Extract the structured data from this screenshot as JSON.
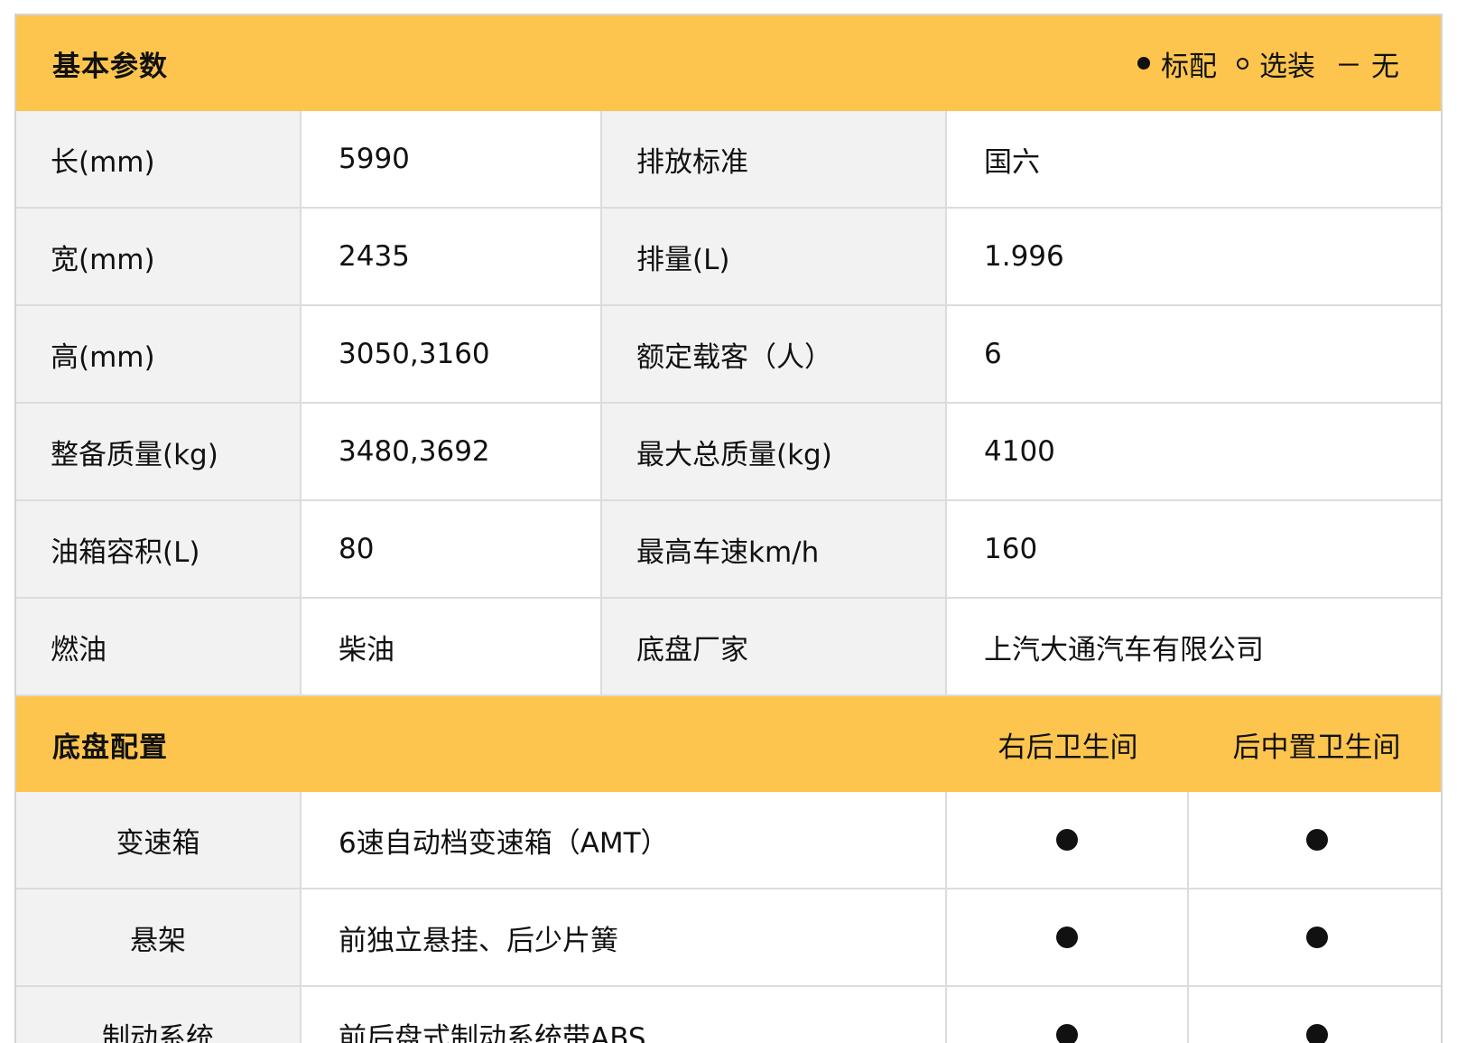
{
  "basic": {
    "title": "基本参数",
    "legend": {
      "standard_label": "标配",
      "optional_label": "选装",
      "none_symbol": "－",
      "none_label": "无"
    },
    "rows": [
      {
        "label1": "长(mm)",
        "value1": "5990",
        "label2": "排放标准",
        "value2": "国六"
      },
      {
        "label1": "宽(mm)",
        "value1": "2435",
        "label2": "排量(L)",
        "value2": "1.996"
      },
      {
        "label1": "高(mm)",
        "value1": "3050,3160",
        "label2": "额定载客（人）",
        "value2": "6"
      },
      {
        "label1": "整备质量(kg)",
        "value1": "3480,3692",
        "label2": "最大总质量(kg)",
        "value2": "4100"
      },
      {
        "label1": "油箱容积(L)",
        "value1": "80",
        "label2": "最高车速km/h",
        "value2": "160"
      },
      {
        "label1": "燃油",
        "value1": "柴油",
        "label2": "底盘厂家",
        "value2": "上汽大通汽车有限公司"
      }
    ]
  },
  "chassis": {
    "title": "底盘配置",
    "columns": [
      "右后卫生间",
      "后中置卫生间"
    ],
    "rows": [
      {
        "label": "变速箱",
        "value": "6速自动档变速箱（AMT）",
        "marks": [
          "standard",
          "standard"
        ]
      },
      {
        "label": "悬架",
        "value": "前独立悬挂、后少片簧",
        "marks": [
          "standard",
          "standard"
        ]
      },
      {
        "label": "制动系统",
        "value": "前后盘式制动系统带ABS",
        "marks": [
          "standard",
          "standard"
        ]
      }
    ]
  }
}
